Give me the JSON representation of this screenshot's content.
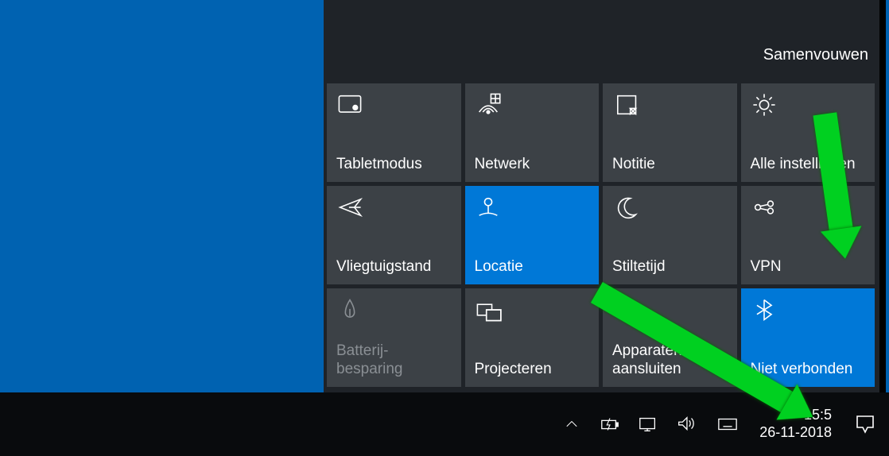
{
  "action_center": {
    "collapse_label": "Samenvouwen",
    "tiles": [
      {
        "icon": "tablet-mode-icon",
        "label": "Tabletmodus",
        "active": false,
        "disabled": false
      },
      {
        "icon": "network-icon",
        "label": "Netwerk",
        "active": false,
        "disabled": false
      },
      {
        "icon": "note-icon",
        "label": "Notitie",
        "active": false,
        "disabled": false
      },
      {
        "icon": "gear-icon",
        "label": "Alle instellingen",
        "active": false,
        "disabled": false
      },
      {
        "icon": "airplane-icon",
        "label": "Vliegtuigstand",
        "active": false,
        "disabled": false
      },
      {
        "icon": "location-icon",
        "label": "Locatie",
        "active": true,
        "disabled": false
      },
      {
        "icon": "moon-icon",
        "label": "Stiltetijd",
        "active": false,
        "disabled": false
      },
      {
        "icon": "vpn-icon",
        "label": "VPN",
        "active": false,
        "disabled": false
      },
      {
        "icon": "battery-saver-icon",
        "label": "Batterij-besparing",
        "active": false,
        "disabled": true
      },
      {
        "icon": "project-icon",
        "label": "Projecteren",
        "active": false,
        "disabled": false
      },
      {
        "icon": "connect-devices-icon",
        "label": "Apparaten aansluiten",
        "active": false,
        "disabled": false
      },
      {
        "icon": "bluetooth-icon",
        "label": "Niet verbonden",
        "active": true,
        "disabled": false
      }
    ]
  },
  "taskbar": {
    "time": "15:5",
    "date": "26-11-2018"
  },
  "icons": {
    "tablet-mode-icon": "<rect x='3' y='5' width='24' height='18' rx='2'/><circle cx='21' cy='18' r='2.5' fill='#fff'/>",
    "network-icon": "<path d='M5 23 q10 -14 20 0' /><path d='M9 23 q6 -8 12 0'/><circle cx='15' cy='23' r='1.6' fill='#fff'/><rect x='18' y='3' width='10' height='10'/><line x1='23' y1='3' x2='23' y2='13'/><line x1='18' y1='8' x2='28' y2='8'/>",
    "note-icon": "<rect x='6' y='5' width='20' height='20'/><path d='M20 19 L26 25 L26 19 Z' fill='#3c4146'/><path d='M20 19 L26 19 L20 25 Z' />",
    "gear-icon": "<circle cx='15' cy='15' r='5'/><g><line x1='15' y1='3' x2='15' y2='7'/><line x1='15' y1='23' x2='15' y2='27'/><line x1='3' y1='15' x2='7' y2='15'/><line x1='23' y1='15' x2='27' y2='15'/><line x1='6.5' y1='6.5' x2='9.3' y2='9.3'/><line x1='20.7' y1='20.7' x2='23.5' y2='23.5'/><line x1='6.5' y1='23.5' x2='9.3' y2='20.7'/><line x1='20.7' y1='9.3' x2='23.5' y2='6.5'/></g>",
    "airplane-icon": "<path d='M4 15 L27 6 L20 15 L27 24 L4 15 Z'/><line x1='14' y1='15' x2='27' y2='15'/>",
    "location-icon": "<circle cx='15' cy='9' r='4'/><line x1='15' y1='13' x2='15' y2='22'/><path d='M5 24 q10 -5 20 0'/>",
    "moon-icon": "<path d='M20 5 a11 11 0 1 0 6 18 a9 9 0 0 1 -6 -18 Z'/>",
    "vpn-icon": "<circle cx='8' cy='15' r='3'/><circle cx='22' cy='11' r='3'/><circle cx='22' cy='19' r='3'/><line x1='10.5' y1='13.8' x2='19.5' y2='11.8'/><line x1='10.5' y1='16.2' x2='19.5' y2='18.2'/>",
    "battery-saver-icon": "<path d='M15 4 q-5 8 -5 14 a5 5 0 0 0 10 0 q0 -6 -5 -14 Z'/><line x1='15' y1='14' x2='15' y2='22'/>",
    "project-icon": "<rect x='3' y='9' width='16' height='12'/><rect x='13' y='15' width='16' height='12' fill='#3c4146'/><rect x='13' y='15' width='16' height='12'/>",
    "connect-devices-icon": "<rect x='3' y='7' width='16' height='12'/><line x1='7' y1='22' x2='15' y2='22'/><rect x='21' y='10' width='9' height='15'/><circle cx='25.5' cy='22' r='1' fill='#fff'/>",
    "bluetooth-icon": "<path d='M15 4 L15 26 L23 20 L7 10 M15 4 L23 10 L7 20'/>",
    "power-icon": "<rect x='3' y='9' width='19' height='11'/><rect x='22' y='12' width='3' height='5' fill='#fff'/><path d='M14 6 L10 15 L14 15 L11 22' stroke-width='1.2'/>",
    "monitor-icon": "<rect x='3' y='6' width='20' height='14'/><line x1='9' y1='23' x2='17' y2='23'/><line x1='13' y1='20' x2='13' y2='23'/>",
    "volume-icon": "<path d='M4 11 L9 11 L15 5 L15 21 L9 15 L4 15 Z'/><path d='M18 9 a6 6 0 0 1 0 8'/><path d='M21 6 a10 10 0 0 1 0 14'/>",
    "keyboard-icon": "<rect x='2' y='7' width='24' height='14'/><line x1='6' y1='11' x2='6' y2='11'/><line x1='10' y1='11' x2='10' y2='11'/><line x1='14' y1='11' x2='14' y2='11'/><line x1='18' y1='11' x2='18' y2='11'/><line x1='22' y1='11' x2='22' y2='11'/><line x1='8' y1='17' x2='20' y2='17'/>",
    "chevron-up-icon": "<polyline points='4,17 13,8 22,17'/>",
    "action-center-tray-icon": "<path d='M4 4 L24 4 L24 18 L17 18 L14 24 L11 18 L4 18 Z'/>"
  }
}
